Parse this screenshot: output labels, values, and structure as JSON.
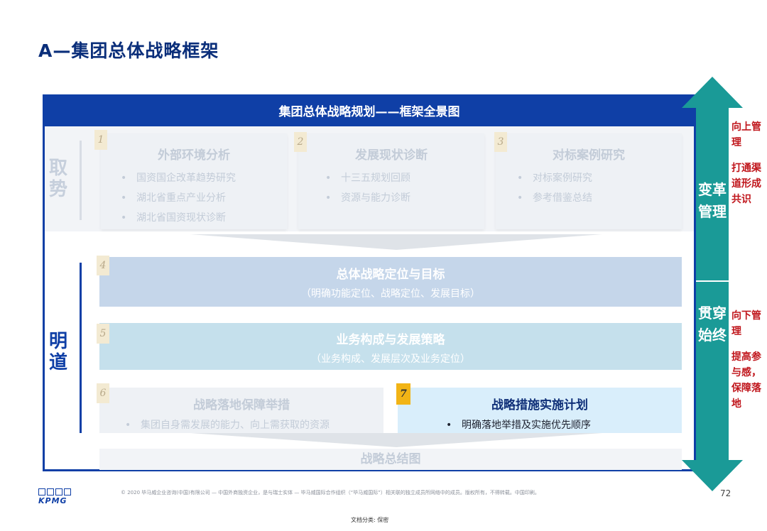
{
  "page": {
    "title": "A—集团总体战略框架",
    "page_number": "72",
    "copyright": "© 2020 毕马威企业咨询(中国)有限公司 — 中国外商独资企业，是与瑞士实体 — 毕马威国际合作组织（“毕马威国际”）相关联的独立成员所网络中的成员。版权所有，不得转载。中国印刷。",
    "doc_classification": "文档分类: 保密",
    "logo_text": "KPMG"
  },
  "framework": {
    "header": "集团总体战略规划——框架全景图",
    "side_labels": {
      "quzhi": "取势",
      "mingdao": "明道"
    },
    "boxes": [
      {
        "num": "1",
        "title": "外部环境分析",
        "bullets": [
          "国资国企改革趋势研究",
          "湖北省重点产业分析",
          "湖北省国资现状诊断"
        ]
      },
      {
        "num": "2",
        "title": "发展现状诊断",
        "bullets": [
          "十三五规划回顾",
          "资源与能力诊断"
        ]
      },
      {
        "num": "3",
        "title": "对标案例研究",
        "bullets": [
          "对标案例研究",
          "参考借鉴总结"
        ]
      },
      {
        "num": "4",
        "title": "总体战略定位与目标",
        "subtitle": "（明确功能定位、战略定位、发展目标）"
      },
      {
        "num": "5",
        "title": "业务构成与发展策略",
        "subtitle": "（业务构成、发展层次及业务定位）"
      },
      {
        "num": "6",
        "title": "战略落地保障举措",
        "bullets": [
          "集团自身需发展的能力、向上需获取的资源"
        ]
      },
      {
        "num": "7",
        "title": "战略措施实施计划",
        "bullets": [
          "明确落地举措及实施优先顺序"
        ]
      }
    ],
    "summary": "战略总结图"
  },
  "arrow": {
    "upper_text": "变革管理",
    "lower_text": "贯穿始终",
    "color": "#1a9a97"
  },
  "notes": {
    "up_1": "向上管理",
    "up_2": "打通渠道形成共识",
    "down_1": "向下管理",
    "down_2": "提高参与感，保障落地"
  },
  "colors": {
    "brand_blue": "#0f3fa6",
    "accent_red": "#c0161c",
    "highlight_yellow": "#f2b416"
  }
}
